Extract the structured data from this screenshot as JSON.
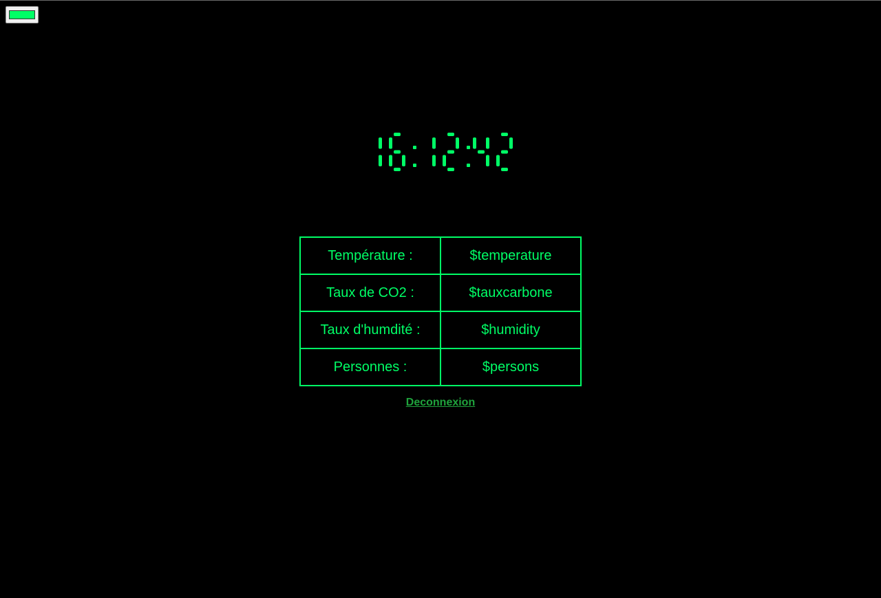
{
  "colors": {
    "background": "#000000",
    "accent": "#00ff66",
    "link": "#1fa33c"
  },
  "color_picker": {
    "value": "#00ff66"
  },
  "clock": {
    "time": "16:12:42"
  },
  "readings": [
    {
      "label": "Température :",
      "value": "$temperature"
    },
    {
      "label": "Taux de CO2 :",
      "value": "$tauxcarbone"
    },
    {
      "label": "Taux d'humdité :",
      "value": "$humidity"
    },
    {
      "label": "Personnes :",
      "value": "$persons"
    }
  ],
  "logout_label": "Deconnexion"
}
